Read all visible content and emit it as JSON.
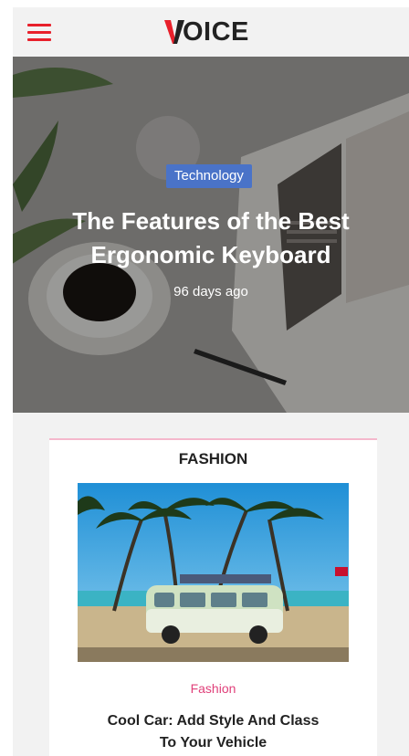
{
  "header": {
    "logo_text": "OICE",
    "menu_icon": "hamburger-menu-icon",
    "accent_color": "#e8202b"
  },
  "hero": {
    "tag": "Technology",
    "title": "The Features of the Best Ergonomic Keyboard",
    "date": "96 days ago",
    "tag_color": "#4a73c8"
  },
  "card": {
    "section_title": "FASHION",
    "category": "Fashion",
    "title": "Cool Car: Add Style And Class To Your Vehicle",
    "category_color": "#e0407a"
  }
}
